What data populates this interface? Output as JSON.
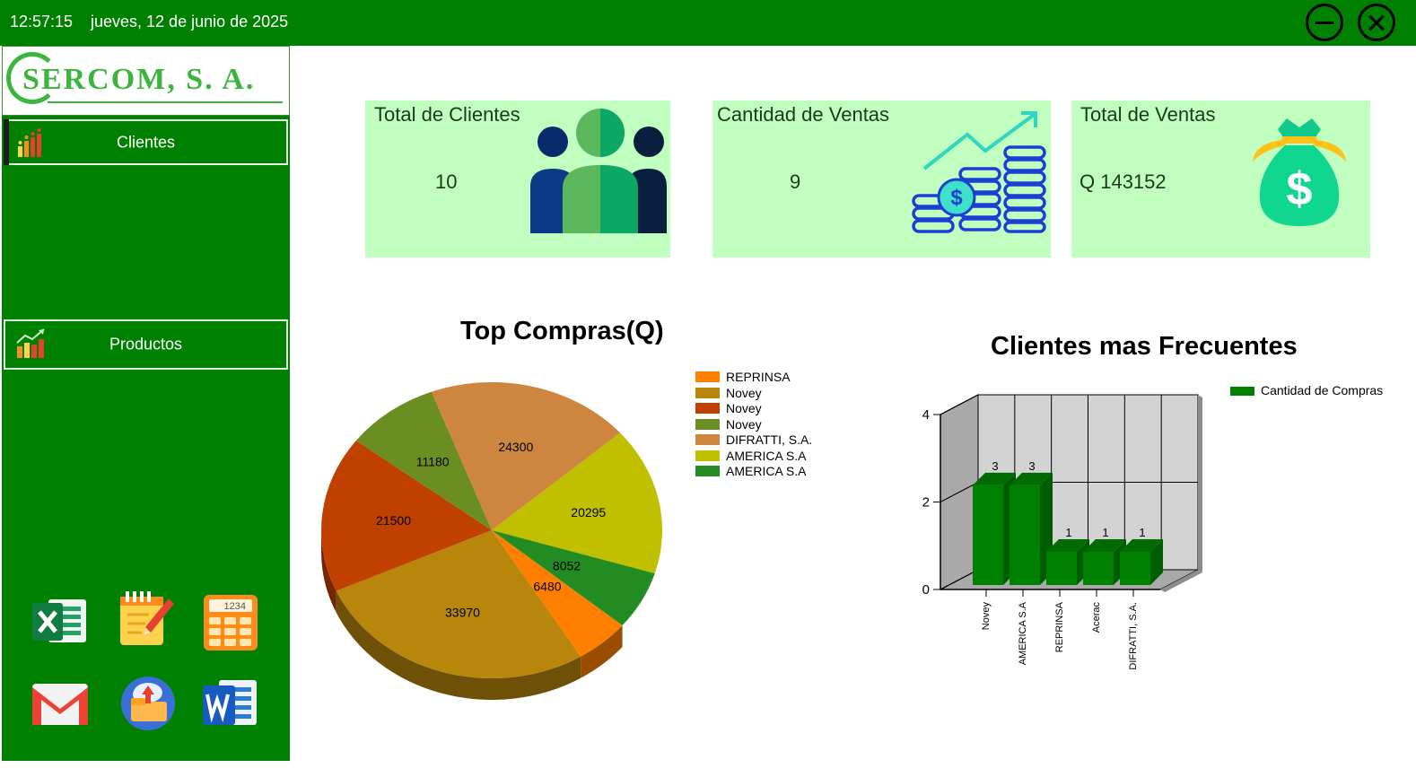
{
  "window": {
    "time": "12:57:15",
    "date": "jueves, 12 de junio de 2025"
  },
  "brand": {
    "logo_text": "SERCOM, S. A.",
    "primary_color": "#008000",
    "card_color": "#c0ffc0"
  },
  "sidebar": {
    "items": [
      {
        "label": "Clientes",
        "icon": "bar-chart-icon"
      },
      {
        "label": "Productos",
        "icon": "growth-chart-icon"
      }
    ],
    "apps": [
      {
        "name": "excel-icon"
      },
      {
        "name": "notepad-icon"
      },
      {
        "name": "calculator-icon"
      },
      {
        "name": "gmail-icon"
      },
      {
        "name": "cloud-folder-icon"
      },
      {
        "name": "word-icon"
      }
    ],
    "calculator_display": "1234"
  },
  "cards": [
    {
      "title": "Total de Clientes",
      "value": "10",
      "icon": "people-icon"
    },
    {
      "title": "Cantidad de Ventas",
      "value": "9",
      "icon": "coins-growth-icon"
    },
    {
      "title": "Total de Ventas",
      "value": "Q  143152",
      "icon": "money-bag-icon"
    }
  ],
  "chart_data": [
    {
      "type": "pie",
      "title": "Top Compras(Q)",
      "slices": [
        {
          "label": "REPRINSA",
          "value": 6480,
          "color": "#ff8000"
        },
        {
          "label": "Novey",
          "value": 33970,
          "color": "#b8860b"
        },
        {
          "label": "Novey",
          "value": 21500,
          "color": "#c04000"
        },
        {
          "label": "Novey",
          "value": 11180,
          "color": "#6b8e23"
        },
        {
          "label": "DIFRATTI, S.A.",
          "value": 24300,
          "color": "#cd853f"
        },
        {
          "label": "AMERICA S.A",
          "value": 20295,
          "color": "#c0c000"
        },
        {
          "label": "AMERICA S.A",
          "value": 8052,
          "color": "#228b22"
        }
      ],
      "legend_position": "right"
    },
    {
      "type": "bar",
      "title": "Clientes mas Frecuentes",
      "categories": [
        "Novey",
        "AMERICA S.A",
        "REPRINSA",
        "Acerac",
        "DIFRATTI, S.A."
      ],
      "series": [
        {
          "name": "Cantidad de Compras",
          "values": [
            3,
            3,
            1,
            1,
            1
          ],
          "color": "#008000"
        }
      ],
      "ylim": [
        0,
        4
      ],
      "yticks": [
        "0",
        "2",
        "4"
      ],
      "grid": true,
      "style": "3d",
      "legend_position": "top-right"
    }
  ]
}
